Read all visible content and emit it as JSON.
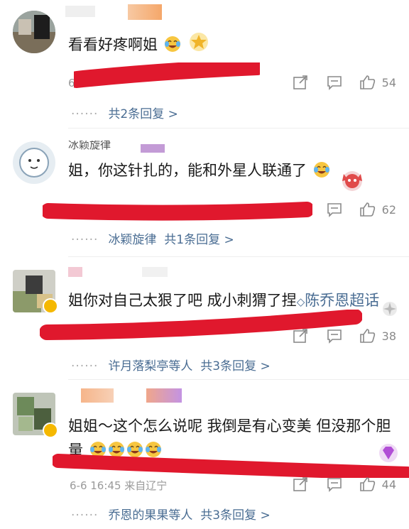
{
  "comments": [
    {
      "text": "看看好疼啊姐",
      "meta": "6",
      "likes": "54",
      "reply": "共2条回复 >",
      "reply_names": ""
    },
    {
      "username": "冰颖旋律",
      "text": "姐，你这针扎的，能和外星人联通了",
      "likes": "62",
      "reply_names": "冰颖旋律",
      "reply": "共1条回复 >"
    },
    {
      "text": "姐你对自己太狠了吧 成小刺猬了捏",
      "topic": "陈乔恩超话",
      "likes": "38",
      "reply_names": "许月落梨亭等人",
      "reply": "共3条回复 >"
    },
    {
      "text_line1": "姐姐～这个怎么说呢 我倒是有心变美 但没那个胆",
      "text_line2": "量",
      "meta": "6-6 16:45  来自辽宁",
      "likes": "44",
      "reply_names": "乔恩的果果等人",
      "reply": "共3条回复 >"
    }
  ],
  "icons": {
    "share": "share-icon",
    "comment": "comment-icon",
    "like": "thumbs-up-icon"
  },
  "colors": {
    "link": "#4a6d93",
    "red_mark": "#e0182d"
  }
}
